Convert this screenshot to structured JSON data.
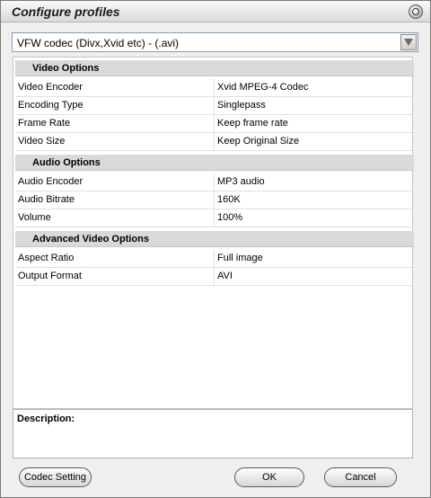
{
  "window": {
    "title": "Configure profiles"
  },
  "profile": {
    "selected": "VFW codec (Divx,Xvid etc) - (.avi)"
  },
  "sections": [
    {
      "title": "Video Options",
      "rows": [
        {
          "key": "Video Encoder",
          "value": "Xvid MPEG-4 Codec"
        },
        {
          "key": "Encoding Type",
          "value": "Singlepass"
        },
        {
          "key": "Frame Rate",
          "value": "Keep frame rate"
        },
        {
          "key": "Video Size",
          "value": "Keep Original Size"
        }
      ]
    },
    {
      "title": "Audio Options",
      "rows": [
        {
          "key": "Audio Encoder",
          "value": "MP3 audio"
        },
        {
          "key": "Audio Bitrate",
          "value": "160K"
        },
        {
          "key": "Volume",
          "value": "100%"
        }
      ]
    },
    {
      "title": "Advanced Video Options",
      "rows": [
        {
          "key": "Aspect Ratio",
          "value": "Full image"
        },
        {
          "key": "Output Format",
          "value": "AVI"
        }
      ]
    }
  ],
  "description": {
    "label": "Description:"
  },
  "buttons": {
    "codec_setting": "Codec Setting",
    "ok": "OK",
    "cancel": "Cancel"
  }
}
